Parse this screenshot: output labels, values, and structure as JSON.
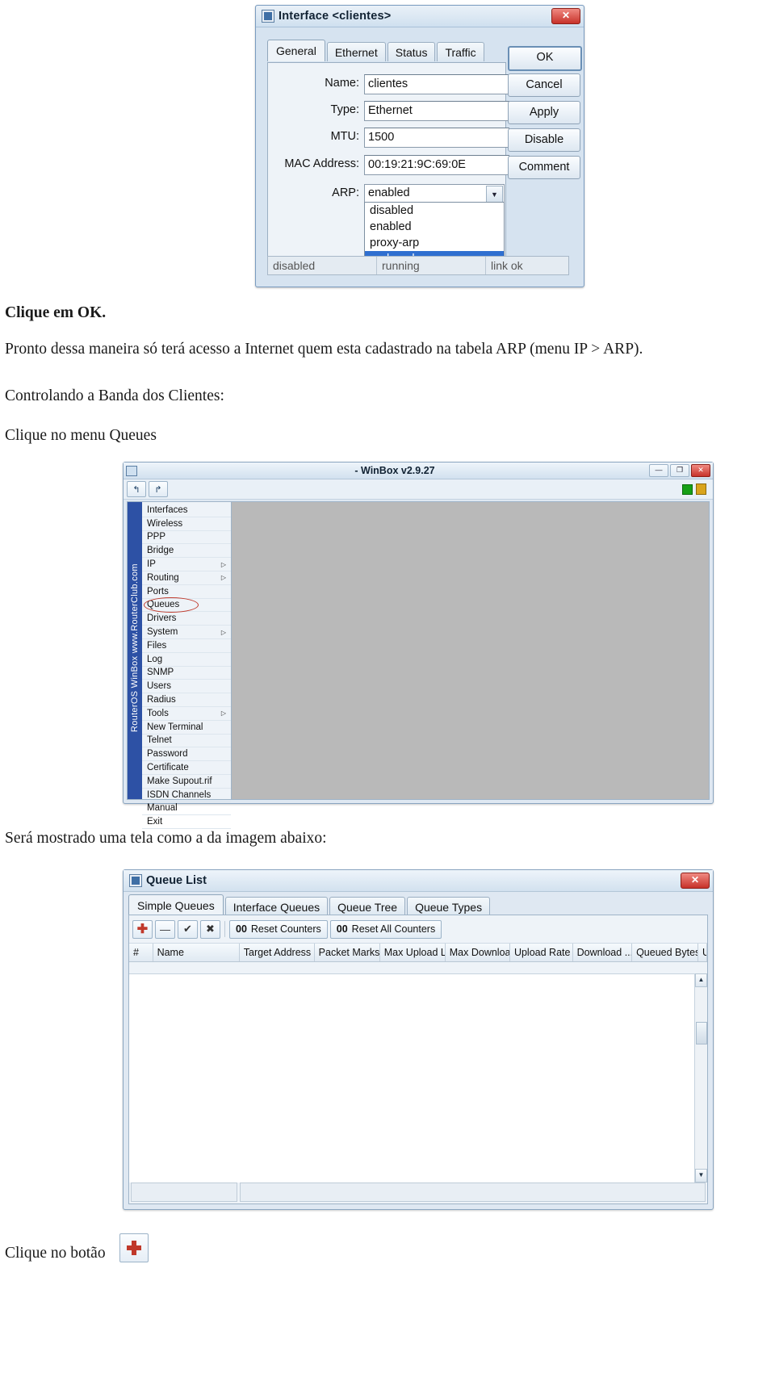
{
  "iface_window": {
    "title": "Interface <clientes>",
    "close_label": "✕",
    "tabs": [
      {
        "label": "General",
        "active": true
      },
      {
        "label": "Ethernet",
        "active": false
      },
      {
        "label": "Status",
        "active": false
      },
      {
        "label": "Traffic",
        "active": false
      }
    ],
    "fields": [
      {
        "label": "Name:",
        "value": "clientes"
      },
      {
        "label": "Type:",
        "value": "Ethernet"
      },
      {
        "label": "MTU:",
        "value": "1500"
      },
      {
        "label": "MAC Address:",
        "value": "00:19:21:9C:69:0E"
      }
    ],
    "arp": {
      "label": "ARP:",
      "value": "enabled",
      "arrow": "▼",
      "options": [
        "disabled",
        "enabled",
        "proxy-arp",
        "reply-only"
      ],
      "selected_option": "reply-only"
    },
    "buttons": [
      "OK",
      "Cancel",
      "Apply",
      "Disable",
      "Comment"
    ],
    "status": [
      "disabled",
      "running",
      "link ok"
    ]
  },
  "paragraphs": {
    "p1": "Clique em OK.",
    "p2": "Pronto dessa maneira só terá acesso a Internet quem esta cadastrado na tabela ARP (menu IP > ARP).",
    "p3": "Controlando a Banda dos Clientes:",
    "p4": "Clique no menu Queues",
    "p5": "Será mostrado uma tela como a da imagem abaixo:",
    "p6": "Clique no botão"
  },
  "winbox": {
    "title": "- WinBox v2.9.27",
    "window_buttons": [
      "—",
      "❐",
      "✕"
    ],
    "toolbar_icons": [
      "undo-icon",
      "redo-icon"
    ],
    "status_icons": [
      "green-square-icon",
      "lock-icon"
    ],
    "brand": "RouterOS WinBox  www.RouterClub.com",
    "menu": [
      {
        "label": "Interfaces",
        "submenu": false
      },
      {
        "label": "Wireless",
        "submenu": false
      },
      {
        "label": "PPP",
        "submenu": false
      },
      {
        "label": "Bridge",
        "submenu": false
      },
      {
        "label": "IP",
        "submenu": true
      },
      {
        "label": "Routing",
        "submenu": true
      },
      {
        "label": "Ports",
        "submenu": false
      },
      {
        "label": "Queues",
        "submenu": false,
        "highlighted": true
      },
      {
        "label": "Drivers",
        "submenu": false
      },
      {
        "label": "System",
        "submenu": true
      },
      {
        "label": "Files",
        "submenu": false
      },
      {
        "label": "Log",
        "submenu": false
      },
      {
        "label": "SNMP",
        "submenu": false
      },
      {
        "label": "Users",
        "submenu": false
      },
      {
        "label": "Radius",
        "submenu": false
      },
      {
        "label": "Tools",
        "submenu": true
      },
      {
        "label": "New Terminal",
        "submenu": false
      },
      {
        "label": "Telnet",
        "submenu": false
      },
      {
        "label": "Password",
        "submenu": false
      },
      {
        "label": "Certificate",
        "submenu": false
      },
      {
        "label": "Make Supout.rif",
        "submenu": false
      },
      {
        "label": "ISDN Channels",
        "submenu": false
      },
      {
        "label": "Manual",
        "submenu": false
      },
      {
        "label": "Exit",
        "submenu": false
      }
    ]
  },
  "queue_window": {
    "title": "Queue List",
    "close_label": "✕",
    "tabs": [
      {
        "label": "Simple Queues",
        "active": true
      },
      {
        "label": "Interface Queues",
        "active": false
      },
      {
        "label": "Queue Tree",
        "active": false
      },
      {
        "label": "Queue Types",
        "active": false
      }
    ],
    "toolbar": {
      "add": "✚",
      "remove": "—",
      "enable": "✔",
      "disable": "✖",
      "reset_counters_count": "00",
      "reset_counters_label": "Reset Counters",
      "reset_all_count": "00",
      "reset_all_label": "Reset All Counters"
    },
    "columns": [
      "#",
      "Name",
      "Target Address",
      "Packet Marks",
      "Max Upload L...",
      "Max Downloa...",
      "Upload Rate",
      "Download ...",
      "Queued Bytes",
      "Up"
    ],
    "rows": [],
    "scroll": {
      "up": "▲",
      "down": "▼"
    }
  }
}
